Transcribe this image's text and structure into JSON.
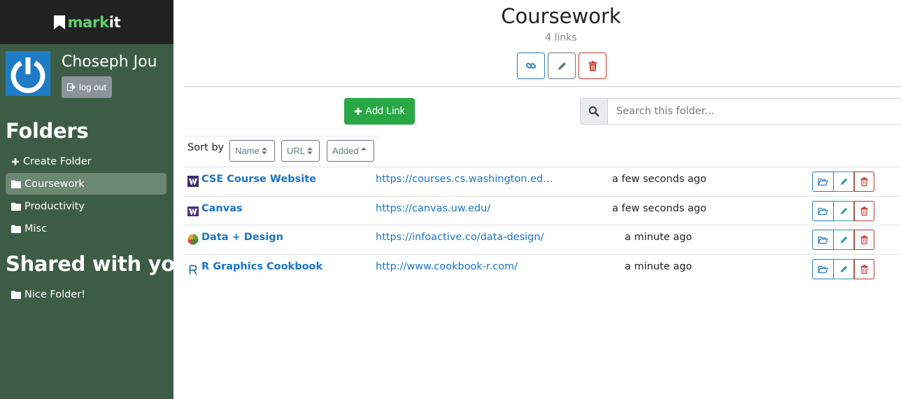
{
  "brand": {
    "name_part1": "mark",
    "name_part2": "it"
  },
  "user": {
    "name": "Choseph Jou",
    "logout_label": "log out"
  },
  "sidebar": {
    "folders_heading": "Folders",
    "create_folder_label": "Create Folder",
    "folders": [
      {
        "label": "Coursework",
        "active": true
      },
      {
        "label": "Productivity",
        "active": false
      },
      {
        "label": "Misc",
        "active": false
      }
    ],
    "shared_heading": "Shared with you",
    "shared": [
      {
        "label": "Nice Folder!"
      }
    ]
  },
  "folder": {
    "title": "Coursework",
    "count_text": "4 links"
  },
  "toolbar": {
    "add_link_label": "Add Link",
    "search_placeholder": "Search this folder..."
  },
  "sort": {
    "label": "Sort by",
    "name_label": "Name",
    "url_label": "URL",
    "added_label": "Added"
  },
  "links": [
    {
      "name": "CSE Course Website",
      "url": "https://courses.cs.washington.edu/co...",
      "added": "a few seconds ago",
      "favicon": "uw-w-icon"
    },
    {
      "name": "Canvas",
      "url": "https://canvas.uw.edu/",
      "added": "a few seconds ago",
      "favicon": "uw-w-icon"
    },
    {
      "name": "Data + Design",
      "url": "https://infoactive.co/data-design/",
      "added": "a minute ago",
      "favicon": "pie-chart-icon"
    },
    {
      "name": "R Graphics Cookbook",
      "url": "http://www.cookbook-r.com/",
      "added": "a minute ago",
      "favicon": "r-letter-icon"
    }
  ],
  "colors": {
    "sidebar": "#3d5c45",
    "brand_bar": "#222222",
    "accent_green": "#28a745",
    "link_blue": "#1a73c8",
    "danger": "#c0392b"
  }
}
